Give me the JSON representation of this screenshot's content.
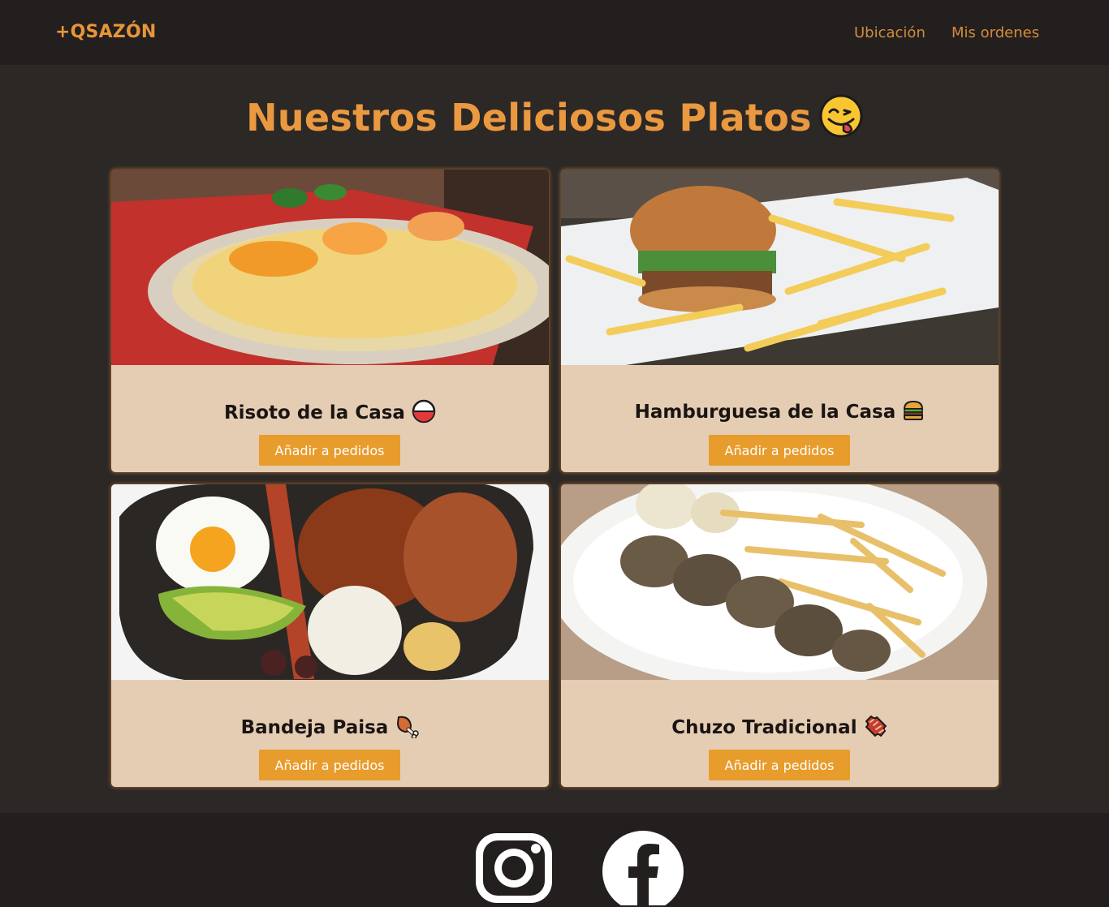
{
  "navbar": {
    "brand": "+QSAZÓN",
    "links": [
      {
        "label": "Ubicación"
      },
      {
        "label": "Mis ordenes"
      }
    ]
  },
  "main": {
    "title": "Nuestros Deliciosos Platos",
    "title_icon": "yum-face-emoji",
    "dishes": [
      {
        "name": "Risoto de la Casa",
        "icon": "rice-bowl-emoji",
        "button": "Añadir a pedidos",
        "image": "risotto-shrimp-photo"
      },
      {
        "name": "Hamburguesa de la Casa",
        "icon": "burger-emoji",
        "button": "Añadir a pedidos",
        "image": "burger-fries-photo"
      },
      {
        "name": "Bandeja Paisa ",
        "icon": "meat-on-bone-emoji",
        "button": "Añadir a pedidos",
        "image": "bandeja-paisa-photo"
      },
      {
        "name": "Chuzo Tradicional",
        "icon": "bacon-emoji",
        "button": "Añadir a pedidos",
        "image": "skewer-fries-photo"
      }
    ]
  },
  "footer": {
    "social": [
      {
        "icon": "instagram-icon"
      },
      {
        "icon": "facebook-icon"
      }
    ]
  },
  "colors": {
    "background": "#2c2826",
    "navbar": "#221f1e",
    "accent": "#ea9940",
    "card": "#e5cdb4",
    "button": "#e79c2c"
  }
}
